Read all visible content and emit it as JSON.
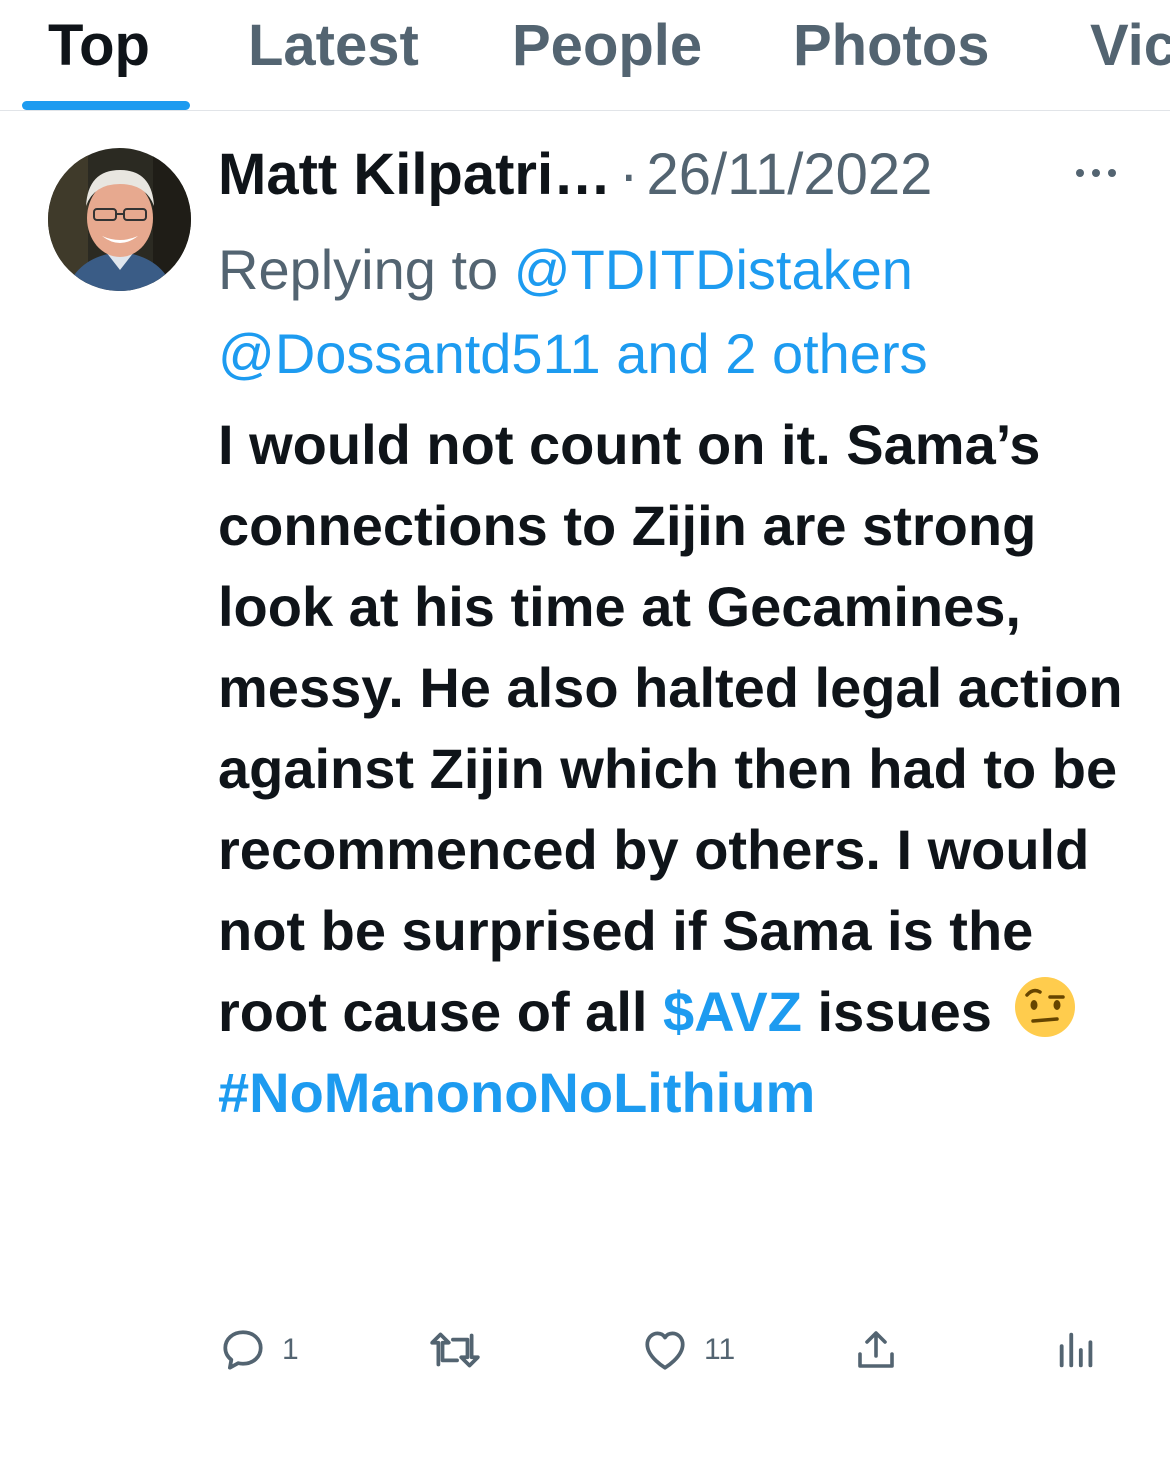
{
  "tabs": [
    {
      "label": "Top",
      "active": true
    },
    {
      "label": "Latest"
    },
    {
      "label": "People"
    },
    {
      "label": "Photos"
    },
    {
      "label": "Vic"
    }
  ],
  "tweet": {
    "author": "Matt Kilpatri…",
    "separator": "·",
    "date": "26/11/2022",
    "replying_prefix": "Replying to ",
    "replying_mentions": "@TDITDistaken @Dossantd511 and 2 others",
    "text": "I would not count on it. Sama’s connections to Zijin are strong look at his time at Gecamines, messy. He also halted legal action against Zijin which then had to be recommenced by others. I would not be surprised if Sama is the root cause of all ",
    "cashtag": "$AVZ",
    "text_after": " issues ",
    "hashtag": "#NoManonoNoLithium",
    "replies": "1",
    "likes": "11"
  },
  "colors": {
    "link": "#1d9bf0",
    "secondary": "#536471",
    "primary": "#0f1419"
  },
  "icons": [
    "more-icon",
    "reply-icon",
    "retweet-icon",
    "like-icon",
    "share-icon",
    "analytics-icon",
    "raised-eyebrow-emoji"
  ]
}
